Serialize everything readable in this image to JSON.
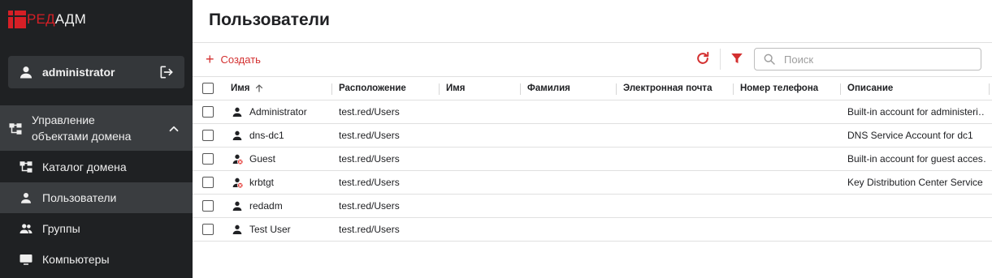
{
  "logo": {
    "part1": "РЕД",
    "part2": "АДМ"
  },
  "user": {
    "name": "administrator"
  },
  "nav": {
    "group_label": "Управление объектами домена",
    "items": [
      {
        "label": "Каталог домена",
        "icon": "tree-icon"
      },
      {
        "label": "Пользователи",
        "icon": "person-icon",
        "active": true
      },
      {
        "label": "Группы",
        "icon": "group-icon"
      },
      {
        "label": "Компьютеры",
        "icon": "computer-icon"
      }
    ]
  },
  "page": {
    "title": "Пользователи"
  },
  "toolbar": {
    "create_label": "Создать",
    "search_placeholder": "Поиск"
  },
  "table": {
    "columns": [
      "Имя",
      "Расположение",
      "Имя",
      "Фамилия",
      "Электронная почта",
      "Номер телефона",
      "Описание"
    ],
    "rows": [
      {
        "name": "Administrator",
        "location": "test.red/Users",
        "first": "",
        "last": "",
        "email": "",
        "phone": "",
        "description": "Built-in account for administeri…",
        "disabled": false
      },
      {
        "name": "dns-dc1",
        "location": "test.red/Users",
        "first": "",
        "last": "",
        "email": "",
        "phone": "",
        "description": "DNS Service Account for dc1",
        "disabled": false
      },
      {
        "name": "Guest",
        "location": "test.red/Users",
        "first": "",
        "last": "",
        "email": "",
        "phone": "",
        "description": "Built-in account for guest acces…",
        "disabled": true
      },
      {
        "name": "krbtgt",
        "location": "test.red/Users",
        "first": "",
        "last": "",
        "email": "",
        "phone": "",
        "description": "Key Distribution Center Service …",
        "disabled": true
      },
      {
        "name": "redadm",
        "location": "test.red/Users",
        "first": "",
        "last": "",
        "email": "",
        "phone": "",
        "description": "",
        "disabled": false
      },
      {
        "name": "Test User",
        "location": "test.red/Users",
        "first": "",
        "last": "",
        "email": "",
        "phone": "",
        "description": "",
        "disabled": false
      }
    ]
  },
  "colors": {
    "accent": "#d32f2f",
    "sidebar_bg": "#1f2123",
    "sidebar_active": "#3a3d40"
  }
}
